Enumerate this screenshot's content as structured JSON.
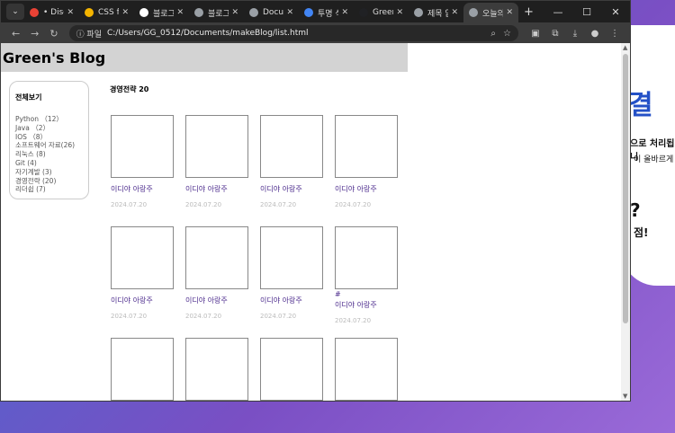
{
  "browser": {
    "tabs": [
      {
        "label": "• Disco",
        "color": "#e94235"
      },
      {
        "label": "CSS fle",
        "color": "#f4b400"
      },
      {
        "label": "블로그",
        "color": "#ffffff"
      },
      {
        "label": "블로그",
        "color": "#9aa0a6"
      },
      {
        "label": "Docum",
        "color": "#9aa0a6"
      },
      {
        "label": "투명 삭",
        "color": "#4285f4"
      },
      {
        "label": "Green",
        "color": "#202124"
      },
      {
        "label": "제목 없",
        "color": "#9aa0a6"
      },
      {
        "label": "오늘의",
        "color": "#9aa0a6",
        "active": true
      }
    ],
    "new_tab_icon": "plus-icon",
    "address_chip": "ⓘ 파일",
    "url": "C:/Users/GG_0512/Documents/makeBlog/list.html"
  },
  "blog": {
    "title": "Green's Blog",
    "sidebar": {
      "heading": "전체보기",
      "categories": [
        "Python （12）",
        "Java （2）",
        "IOS （8）",
        "소프트웨어 자료(26)",
        "리눅스 (8)",
        "Git (4)",
        "자기계발 (3)",
        "경영전략 (20)",
        "리더쉽 (7)"
      ]
    },
    "category_title": "경영전략 20",
    "posts": [
      {
        "title": "이디야 아랑주",
        "date": "2024.07.20"
      },
      {
        "title": "이디야 아랑주",
        "date": "2024.07.20"
      },
      {
        "title": "이디야 아랑주",
        "date": "2024.07.20"
      },
      {
        "title": "이디야 아랑주",
        "date": "2024.07.20"
      },
      {
        "title": "이디야 아랑주",
        "date": "2024.07.20"
      },
      {
        "title": "이디야 아랑주",
        "date": "2024.07.20"
      },
      {
        "title": "이디야 아랑주",
        "date": "2024.07.20"
      },
      {
        "title": "이디야 아랑주",
        "date": "2024.07.20",
        "hash": "#"
      },
      {
        "title": "",
        "date": ""
      },
      {
        "title": "",
        "date": ""
      },
      {
        "title": "",
        "date": ""
      },
      {
        "title": "",
        "date": ""
      }
    ]
  },
  "background_app": {
    "big": "결",
    "line1": "으로 처리됩니",
    "line2": "이 올바르게",
    "q": "?",
    "s": "점!"
  }
}
